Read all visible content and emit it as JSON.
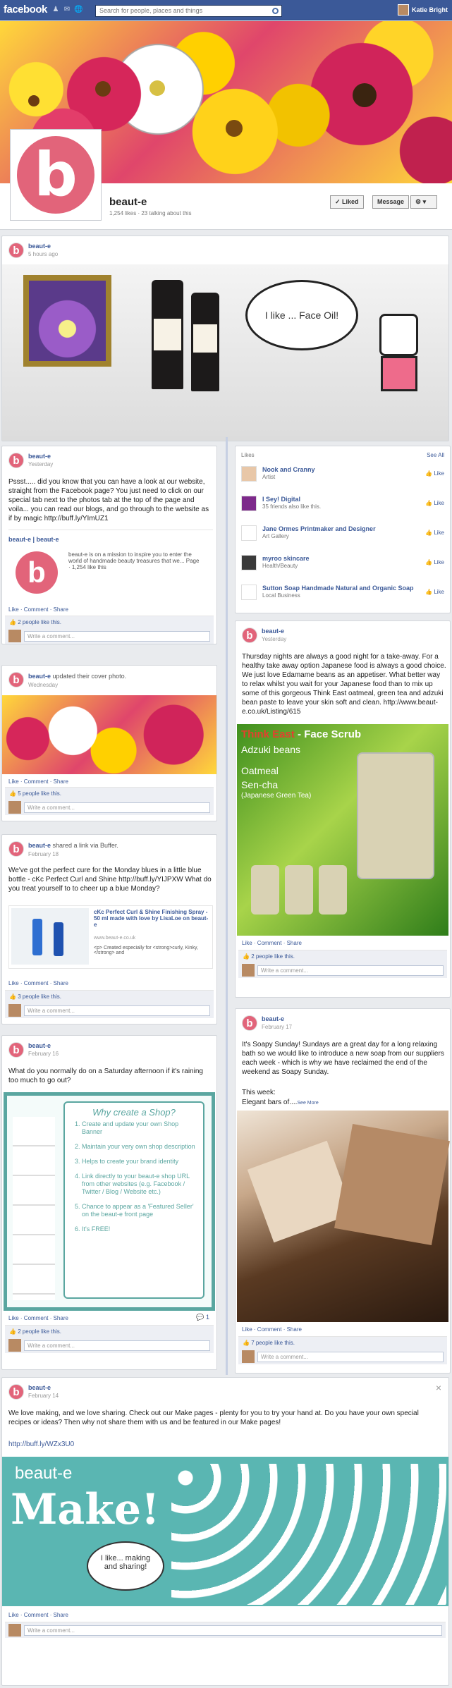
{
  "topbar": {
    "logo": "facebook",
    "search_placeholder": "Search for people, places and things",
    "user_name": "Katie Bright"
  },
  "page": {
    "name": "beaut-e",
    "stats": "1,254 likes · 23 talking about this",
    "liked_label": "Liked",
    "message_label": "Message"
  },
  "sidebar": {
    "title": "Likes",
    "see_all": "See All",
    "items": [
      {
        "name": "Nook and Cranny",
        "category": "Artist",
        "like": "Like"
      },
      {
        "name": "I Sey! Digital",
        "category": "35 friends also like this.",
        "like": "Like"
      },
      {
        "name": "Jane Ormes Printmaker and Designer",
        "category": "Art Gallery",
        "like": "Like"
      },
      {
        "name": "myroo skincare",
        "category": "Health/Beauty",
        "like": "Like"
      },
      {
        "name": "Sutton Soap Handmade Natural and Organic Soap",
        "category": "Local Business",
        "like": "Like"
      }
    ]
  },
  "common": {
    "like": "Like",
    "comment": "Comment",
    "share": "Share",
    "write_comment": "Write a comment...",
    "avatar_letter": "b"
  },
  "posts": {
    "p1": {
      "author": "beaut-e",
      "date": "5 hours ago",
      "bubble": "I like ... Face Oil!"
    },
    "p2": {
      "author": "beaut-e",
      "date": "Yesterday",
      "text": "Pssst..... did you know that you can have a look at our website, straight from the Facebook page? You just need to click on our special tab next to the photos tab at the top of the page and voila... you can read our blogs, and go through to the website as if by magic http://buff.ly/YImUZ1",
      "link_title": "beaut-e | beaut-e",
      "link_desc": "beaut-e is on a mission to inspire you to enter the world of handmade beauty treasures that we... Page · 1,254 like this",
      "likes": "2 people like this."
    },
    "p3": {
      "author": "beaut-e",
      "date": "Yesterday",
      "text": "Thursday nights are always a good night for a take-away. For a healthy take away option Japanese food is always a good choice. We just love Edamame beans as an appetiser. What better way to relax whilst you wait for your Japanese food than to mix up some of this gorgeous Think East oatmeal, green tea and adzuki bean paste to leave your skin soft and clean. http://www.beaut-e.co.uk/Listing/615",
      "img_title_a": "Think East",
      "img_title_b": " - Face Scrub",
      "img_l1": "Adzuki beans",
      "img_l2": "Oatmeal",
      "img_l3": "Sen-cha",
      "img_l4": "(Japanese Green Tea)",
      "likes": "2 people like this."
    },
    "p4": {
      "author": "beaut-e",
      "action": " updated their cover photo.",
      "date": "Wednesday",
      "likes": "5 people like this."
    },
    "p5": {
      "author": "beaut-e",
      "action": " shared a link via Buffer.",
      "date": "February 18",
      "text": "We've got the perfect cure for the Monday blues in a little blue bottle - cKc Perfect Curl and Shine http://buff.ly/YIJPXW What do you treat yourself to to cheer up a blue Monday?",
      "link_title": "cKc Perfect Curl & Shine Finishing Spray - 50 ml made with love by LisaLoe on beaut-e",
      "link_url": "www.beaut-e.co.uk",
      "link_desc": "<p> Created especially for <strong>curly, Kinky,</strong> and",
      "likes": "3 people like this."
    },
    "p6": {
      "author": "beaut-e",
      "date": "February 17",
      "text": "It's Soapy Sunday! Sundays are a great day for a long relaxing bath so we would like to introduce a new soap from our suppliers each week - which is why we have reclaimed the end of the weekend as Soapy Sunday.",
      "text2": "This week:",
      "text3": "Elegant bars of....",
      "see_more": "See More",
      "likes": "7 people like this."
    },
    "p7": {
      "author": "beaut-e",
      "date": "February 16",
      "text": "What do you normally do on a Saturday afternoon if it's raining too much to go out?",
      "shop_title": "Why create a Shop?",
      "shop_items": [
        "Create and update your own Shop Banner",
        "Maintain your very own shop description",
        "Helps to create your brand identity",
        "Link directly to your beaut-e shop URL from other websites (e.g. Facebook / Twitter / Blog / Website etc.)",
        "Chance to appear as a 'Featured Seller' on the beaut-e front page",
        "It's FREE!"
      ],
      "comment_count": "1",
      "likes": "2 people like this."
    },
    "p8": {
      "author": "beaut-e",
      "date": "February 14",
      "text": "We love making, and we love sharing. Check out our Make pages - plenty for you to try your hand at. Do you have your own special recipes or ideas? Then why not share them with us and be featured in our Make pages!",
      "link": "http://buff.ly/WZx3U0",
      "brand": "beaut-e",
      "make": "Make!",
      "bubble": "I like... making and sharing!",
      "close": "×"
    }
  }
}
